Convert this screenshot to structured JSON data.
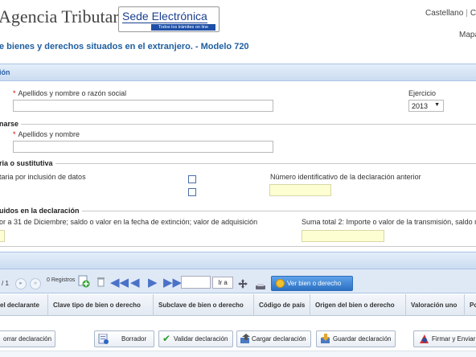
{
  "header": {
    "brand": "Agencia Tributaria",
    "sede_title": "Sede Electrónica",
    "sede_subtitle": "Todos los trámites on line",
    "lang_1": "Castellano",
    "lang_2": "Ca",
    "mapa": "Mapa"
  },
  "page_title": "e bienes y derechos situados en el extranjero. - Modelo 720",
  "band1_label": "ión",
  "form": {
    "apellidos_razon_label": "Apellidos y nombre o razón social",
    "apellidos_razon_value": "",
    "ejercicio_label": "Ejercicio",
    "ejercicio_value": "2013",
    "section_contact": "narse",
    "apellidos_label": "Apellidos y nombre",
    "apellidos_value": "",
    "section_complementaria": "ria o sustitutiva",
    "por_inclusion_label": "taria por inclusión de datos",
    "numero_label": "Número identificativo de la declaración anterior",
    "numero_value": "",
    "section_incluidos": "uidos en la declaración",
    "suma1_label": "or a 31 de Diciembre; saldo o valor en la fecha de extinción; valor de adquisición",
    "suma2_label": "Suma total 2: Importe o valor de la transmisión, saldo me",
    "suma1_value": "",
    "suma2_value": ""
  },
  "toolbar": {
    "page_counter": "/ 1",
    "registros": "0 Registros",
    "page_input": "",
    "ir_a": "Ir a",
    "ver_label": "Ver bien o derecho"
  },
  "table": {
    "headers": [
      "el declarante",
      "Clave tipo de bien o derecho",
      "Subclave de bien o derecho",
      "Código de país",
      "Origen del bien o derecho",
      "Valoración uno",
      "Po"
    ]
  },
  "buttons": {
    "borrar": "orrar declaración",
    "borrador": "Borrador",
    "validar": "Validar declaración",
    "cargar": "Cargar declaración",
    "guardar": "Guardar declaración",
    "firmar": "Firmar y Enviar"
  },
  "colors": {
    "accent": "#1f5fa0",
    "band": "#d6e4f5",
    "required": "#dd0000",
    "highlight_input": "#fefed3"
  }
}
